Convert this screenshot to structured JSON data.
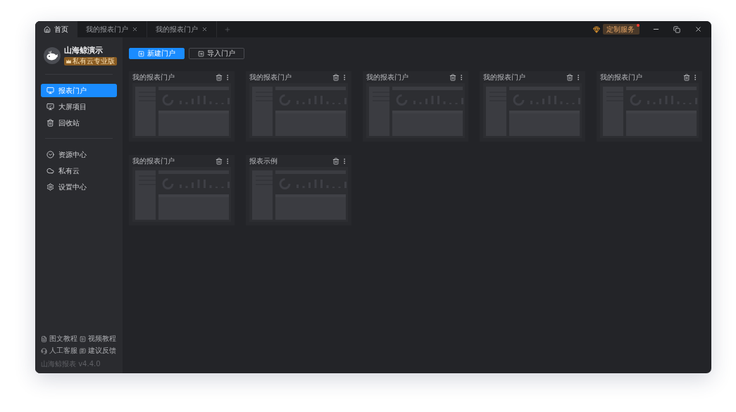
{
  "window": {
    "tabs": [
      {
        "label": "首页",
        "kind": "home",
        "selected": true,
        "closable": false
      },
      {
        "label": "我的报表门户",
        "kind": "page",
        "selected": false,
        "closable": true
      },
      {
        "label": "我的报表门户",
        "kind": "page",
        "selected": false,
        "closable": true
      }
    ],
    "service": {
      "label": "定制服务",
      "notification": true
    }
  },
  "sidebar": {
    "brand": "山海鲸演示",
    "edition": "私有云专业版",
    "nav_sections": [
      {
        "items": [
          {
            "label": "报表门户",
            "selected": true
          },
          {
            "label": "大屏项目",
            "selected": false
          },
          {
            "label": "回收站",
            "selected": false
          }
        ]
      },
      {
        "items": [
          {
            "label": "资源中心",
            "selected": false
          },
          {
            "label": "私有云",
            "selected": false
          },
          {
            "label": "设置中心",
            "selected": false
          }
        ]
      }
    ],
    "footer_links": [
      {
        "label": "图文教程"
      },
      {
        "label": "视频教程"
      },
      {
        "label": "人工客服"
      },
      {
        "label": "建议反馈"
      }
    ],
    "version": "山海鲸报表 v4.4.0"
  },
  "toolbar": {
    "buttons": [
      {
        "label": "新建门户",
        "kind": "primary"
      },
      {
        "label": "导入门户",
        "kind": "secondary"
      }
    ]
  },
  "portals": [
    {
      "title": "我的报表门户"
    },
    {
      "title": "我的报表门户"
    },
    {
      "title": "我的报表门户"
    },
    {
      "title": "我的报表门户"
    },
    {
      "title": "我的报表门户"
    },
    {
      "title": "我的报表门户"
    },
    {
      "title": "报表示例"
    }
  ]
}
